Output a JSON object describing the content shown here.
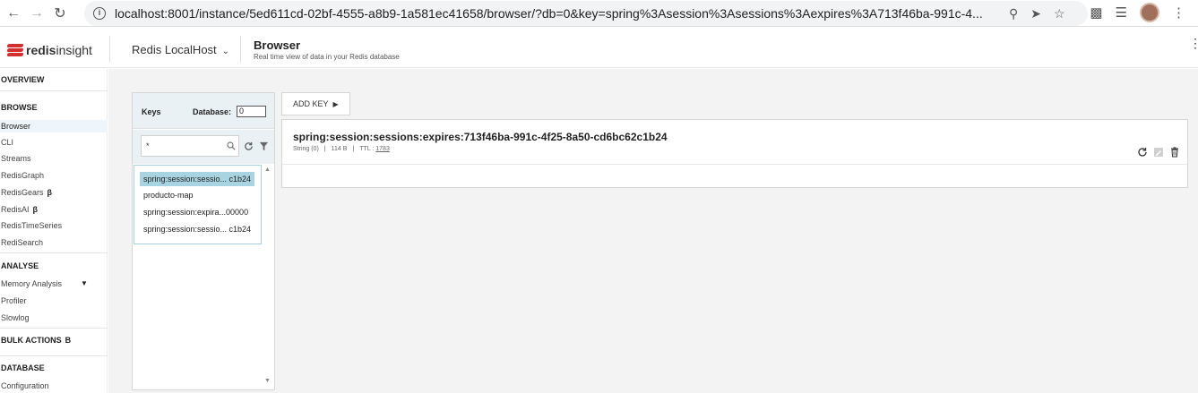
{
  "browser": {
    "url": "localhost:8001/instance/5ed611cd-02bf-4555-a8b9-1a581ec41658/browser/?db=0&key=spring%3Asession%3Asessions%3Aexpires%3A713f46ba-991c-4..."
  },
  "header": {
    "logo_bold": "redis",
    "logo_light": "insight",
    "instance_name": "Redis LocalHost",
    "page_title": "Browser",
    "page_subtitle": "Real time view of data in your Redis database"
  },
  "sidebar": {
    "overview": "OVERVIEW",
    "browse": "BROWSE",
    "browse_items": [
      "Browser",
      "CLI",
      "Streams",
      "RedisGraph",
      "RedisGears",
      "RedisAI",
      "RedisTimeSeries",
      "RediSearch"
    ],
    "beta_symbol": "β",
    "analyse": "ANALYSE",
    "analyse_items": [
      "Memory Analysis",
      "Profiler",
      "Slowlog"
    ],
    "bulk_actions": "BULK ACTIONS",
    "database": "DATABASE",
    "database_items": [
      "Configuration"
    ]
  },
  "keys_panel": {
    "keys_label": "Keys",
    "database_label": "Database:",
    "database_value": "0",
    "search_value": "*",
    "keys": [
      "spring:session:sessio... c1b24",
      "producto-map",
      "spring:session:expira...00000",
      "spring:session:sessio... c1b24"
    ]
  },
  "toolbar": {
    "add_key": "ADD KEY"
  },
  "details": {
    "key_name": "spring:session:sessions:expires:713f46ba-991c-4f25-8a50-cd6bc62c1b24",
    "type": "String (0)",
    "size": "114 B",
    "ttl_label": "TTL :",
    "ttl_value": "1783",
    "separator": "|"
  },
  "colors": {
    "brand_red": "#d32f2f",
    "selected_key_bg": "#a8d3e0",
    "panel_header_bg": "#eaf1f5",
    "main_bg": "#f3f3f3"
  }
}
